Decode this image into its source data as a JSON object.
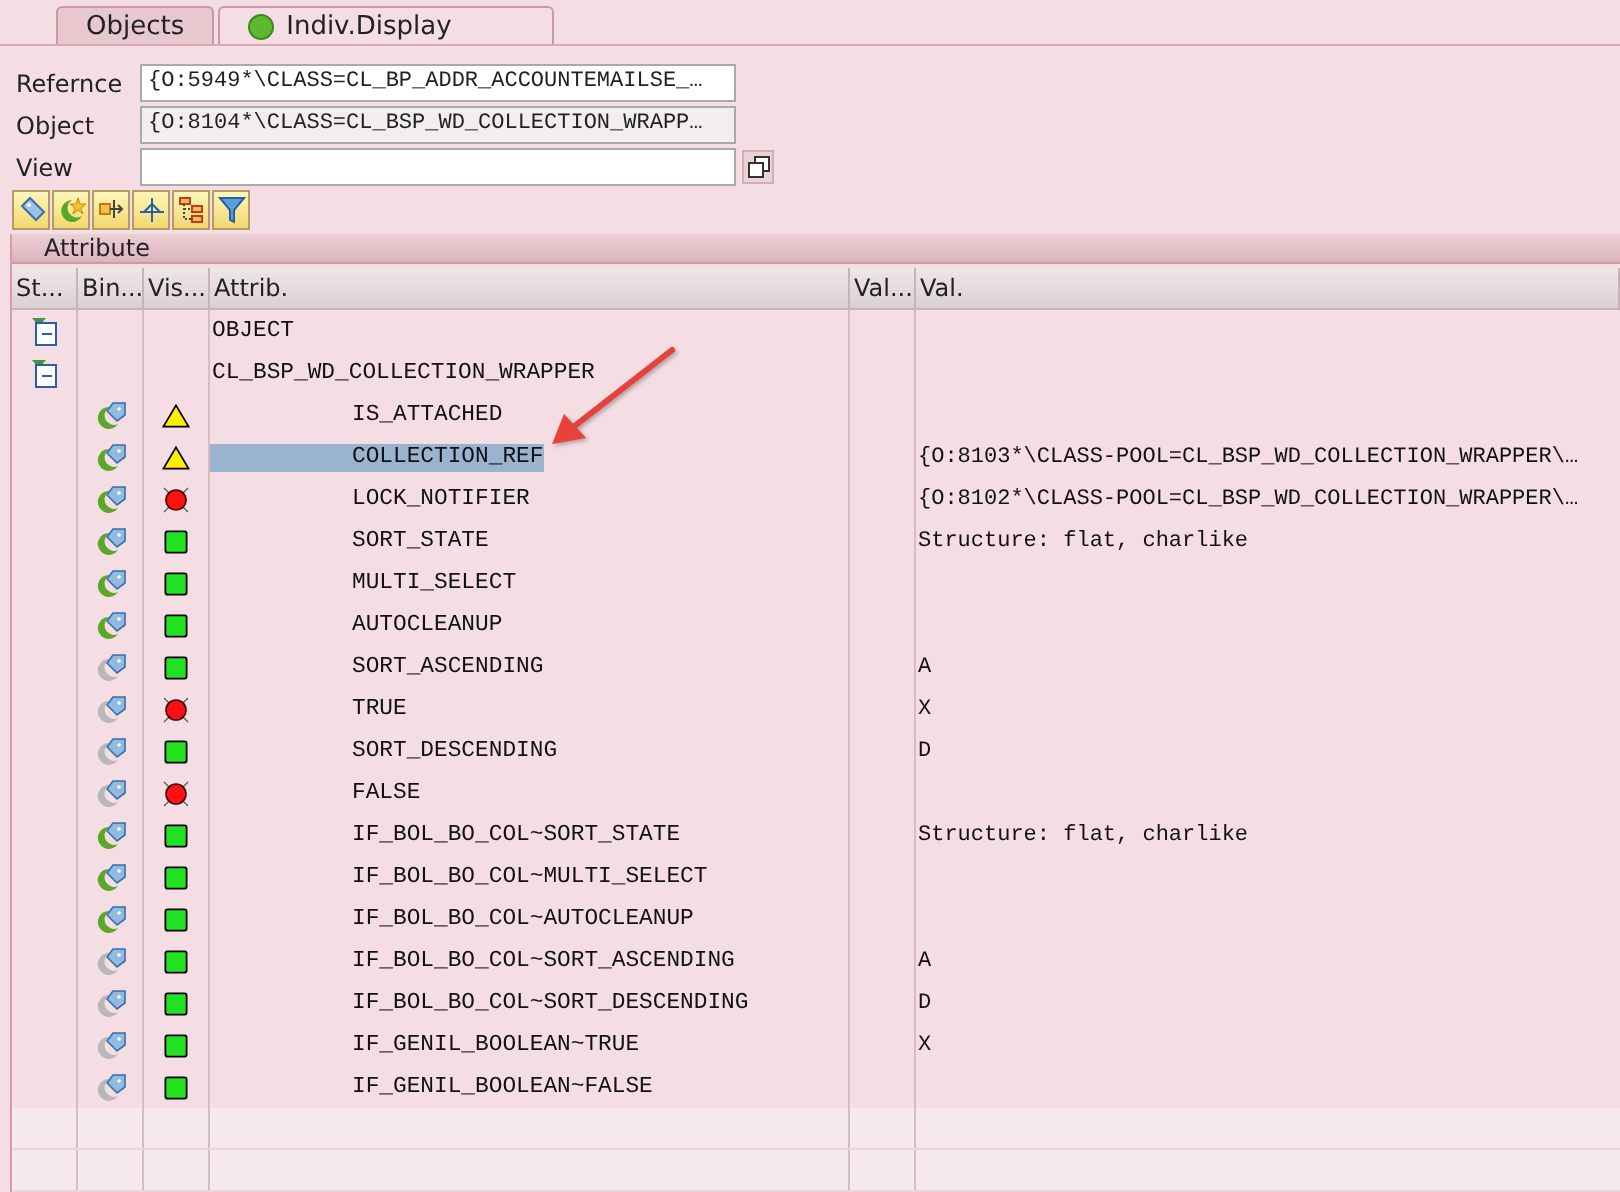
{
  "tabs": [
    {
      "label": "Objects",
      "selected": false
    },
    {
      "label": "Indiv.Display",
      "selected": true
    }
  ],
  "fields": [
    {
      "label": "Refernce",
      "value": "{O:5949*\\CLASS=CL_BP_ADDR_ACCOUNTEMAILSE_…",
      "readonly": false
    },
    {
      "label": "Object",
      "value": "{O:8104*\\CLASS=CL_BSP_WD_COLLECTION_WRAPP…",
      "readonly": true
    },
    {
      "label": "View",
      "readonly": false
    }
  ],
  "panel": {
    "title": "Attribute"
  },
  "table": {
    "columns": [
      "St...",
      "Bin...",
      "Vis...",
      "Attrib.",
      "Val...",
      "Val."
    ],
    "rows": [
      {
        "kind": "node",
        "attrib": "OBJECT",
        "selected": false
      },
      {
        "kind": "node",
        "attrib": "CL_BSP_WD_COLLECTION_WRAPPER",
        "selected": false,
        "children": [
          {
            "kind": "attribute",
            "attrib": "IS_ATTACHED",
            "bound": true,
            "color": "#ffee00",
            "selected": false
          },
          {
            "kind": "attribute",
            "attrib": "COLLECTION_REF",
            "bound": true,
            "color": "#ffee00",
            "selected": true,
            "value": "{O:8103*\\CLASS-POOL=CL_BSP_WD_COLLECTION_WRAPPER\\…"
          },
          {
            "kind": "attribute",
            "attrib": "LOCK_NOTIFIER",
            "bound": true,
            "color": "#ff1010",
            "selected": false,
            "value": "{O:8102*\\CLASS-POOL=CL_BSP_WD_COLLECTION_WRAPPER\\…"
          },
          {
            "kind": "attribute",
            "attrib": "SORT_STATE",
            "bound": true,
            "color": "#22e022",
            "selected": false,
            "value": "Structure: flat, charlike"
          },
          {
            "kind": "attribute",
            "attrib": "MULTI_SELECT",
            "bound": true,
            "color": "#22e022",
            "selected": false
          },
          {
            "kind": "attribute",
            "attrib": "AUTOCLEANUP",
            "bound": true,
            "color": "#22e022",
            "selected": false
          },
          {
            "kind": "attribute",
            "attrib": "SORT_ASCENDING",
            "bound": false,
            "color": "#22e022",
            "selected": false,
            "value": "A"
          },
          {
            "kind": "attribute",
            "attrib": "TRUE",
            "bound": false,
            "color": "#ff1010",
            "selected": false,
            "value": "X"
          },
          {
            "kind": "attribute",
            "attrib": "SORT_DESCENDING",
            "bound": false,
            "color": "#22e022",
            "selected": false,
            "value": "D"
          },
          {
            "kind": "attribute",
            "attrib": "FALSE",
            "bound": false,
            "color": "#ff1010",
            "selected": false
          },
          {
            "kind": "attribute",
            "attrib": "IF_BOL_BO_COL~SORT_STATE",
            "bound": true,
            "color": "#22e022",
            "selected": false,
            "value": "Structure: flat, charlike"
          },
          {
            "kind": "attribute",
            "attrib": "IF_BOL_BO_COL~MULTI_SELECT",
            "bound": true,
            "color": "#22e022",
            "selected": false
          },
          {
            "kind": "attribute",
            "attrib": "IF_BOL_BO_COL~AUTOCLEANUP",
            "bound": true,
            "color": "#22e022",
            "selected": false
          },
          {
            "kind": "attribute",
            "attrib": "IF_BOL_BO_COL~SORT_ASCENDING",
            "bound": false,
            "color": "#22e022",
            "selected": false,
            "value": "A"
          },
          {
            "kind": "attribute",
            "attrib": "IF_BOL_BO_COL~SORT_DESCENDING",
            "bound": false,
            "color": "#22e022",
            "selected": false,
            "value": "D"
          },
          {
            "kind": "attribute",
            "attrib": "IF_GENIL_BOOLEAN~TRUE",
            "bound": false,
            "color": "#22e022",
            "selected": false,
            "value": "X"
          },
          {
            "kind": "attribute",
            "attrib": "IF_GENIL_BOOLEAN~FALSE",
            "bound": false,
            "color": "#22e022",
            "selected": false
          }
        ]
      }
    ]
  }
}
